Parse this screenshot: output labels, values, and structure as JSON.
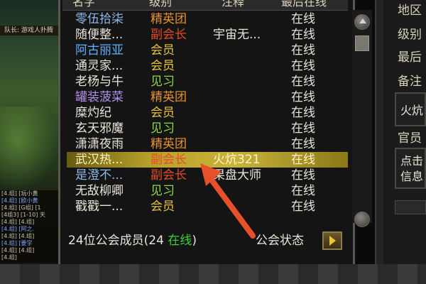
{
  "header": {
    "col_name": "名字",
    "col_rank": "级别",
    "col_note": "注释",
    "col_status": "最后在线"
  },
  "rows": [
    {
      "name": "零伍拾柒",
      "rank": "精英团",
      "note": "",
      "status": "在线",
      "name_color": "#8fb6e8",
      "rank_color": "#e8902a"
    },
    {
      "name": "随便整...",
      "rank": "副会长",
      "note": "宇宙无...",
      "status": "在线",
      "name_color": "#e8e4d8",
      "rank_color": "#e84a2a"
    },
    {
      "name": "阿古丽亚",
      "rank": "会员",
      "note": "",
      "status": "在线",
      "name_color": "#5fb0ff",
      "rank_color": "#e8c43a"
    },
    {
      "name": "通灵家...",
      "rank": "会员",
      "note": "",
      "status": "在线",
      "name_color": "#e8e4d8",
      "rank_color": "#e8c43a"
    },
    {
      "name": "老杨与牛",
      "rank": "见习",
      "note": "",
      "status": "在线",
      "name_color": "#e8e4d8",
      "rank_color": "#8ed84a"
    },
    {
      "name": "罐装菠菜",
      "rank": "精英团",
      "note": "",
      "status": "在线",
      "name_color": "#b090e8",
      "rank_color": "#e8902a"
    },
    {
      "name": "糜灼纪",
      "rank": "会员",
      "note": "",
      "status": "在线",
      "name_color": "#e8e4d8",
      "rank_color": "#e8c43a"
    },
    {
      "name": "玄天邪魔",
      "rank": "见习",
      "note": "",
      "status": "在线",
      "name_color": "#e8e4d8",
      "rank_color": "#8ed84a"
    },
    {
      "name": "潇潇夜雨",
      "rank": "精英团",
      "note": "",
      "status": "在线",
      "name_color": "#e8e4d8",
      "rank_color": "#e8902a"
    },
    {
      "name": "武汉热...",
      "rank": "副会长",
      "note": "火炕321",
      "status": "在线",
      "name_color": "#fff4c8",
      "rank_color": "#e84a2a",
      "selected": true
    },
    {
      "name": "是澄不...",
      "rank": "副会长",
      "note": "果盘大师",
      "status": "在线",
      "name_color": "#8fb6e8",
      "rank_color": "#e84a2a"
    },
    {
      "name": "无敌柳卿",
      "rank": "见习",
      "note": "",
      "status": "在线",
      "name_color": "#e8e4d8",
      "rank_color": "#8ed84a"
    },
    {
      "name": "戳戳一...",
      "rank": "会员",
      "note": "",
      "status": "在线",
      "name_color": "#e8e4d8",
      "rank_color": "#e8c43a"
    }
  ],
  "footer": {
    "count_prefix": "24位公会成员(24 ",
    "count_online": "在线",
    "count_suffix": ")",
    "guild_status_label": "公会状态"
  },
  "info_panel": {
    "label_area": "地区",
    "label_level": "级别",
    "label_last": "最后",
    "label_note": "备注",
    "note_box_text": "火炕",
    "label_officer": "官员",
    "officer_box_line1": "点击",
    "officer_box_line2": "信息"
  },
  "left_scene": {
    "banner": "队长: 游戏人扑腾",
    "chat_lines": [
      "[4.组] [玩小黄",
      "[4.组] [欧小黄",
      "[4.组] [G组] [1",
      "[4组3] [1-10] 天",
      "[4.组] [4.组]",
      "[4.组] [阿之.",
      "[4.组] [4.组]",
      "[4.组] [要学",
      "[4.组] [4.组]",
      "[4.组]"
    ]
  },
  "colors": {
    "selected_row": "#c9b33a",
    "online_green": "#3ad23a",
    "arrow_red": "#e8502a"
  }
}
